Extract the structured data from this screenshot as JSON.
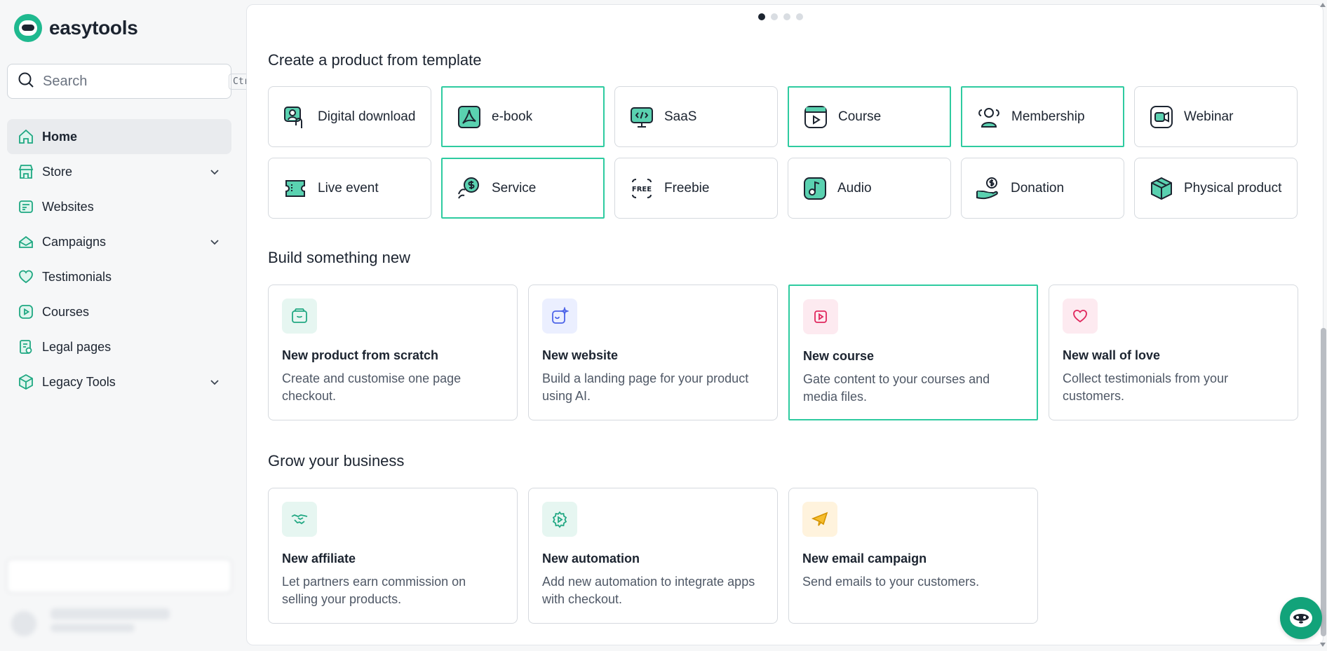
{
  "brand": {
    "name": "easytools",
    "accent": "#2ecba0"
  },
  "search": {
    "placeholder": "Search",
    "shortcut": "Ctrl+K"
  },
  "sidebar": {
    "items": [
      {
        "label": "Home",
        "icon": "home-icon",
        "active": true,
        "expandable": false
      },
      {
        "label": "Store",
        "icon": "store-icon",
        "expandable": true
      },
      {
        "label": "Websites",
        "icon": "websites-icon",
        "expandable": false
      },
      {
        "label": "Campaigns",
        "icon": "campaigns-icon",
        "expandable": true
      },
      {
        "label": "Testimonials",
        "icon": "heart-icon",
        "expandable": false
      },
      {
        "label": "Courses",
        "icon": "play-icon",
        "expandable": false
      },
      {
        "label": "Legal pages",
        "icon": "legal-icon",
        "expandable": false
      },
      {
        "label": "Legacy Tools",
        "icon": "box-icon",
        "expandable": true
      }
    ]
  },
  "carousel": {
    "pages": 4,
    "active": 1
  },
  "templates": {
    "title": "Create a product from template",
    "items": [
      {
        "label": "Digital download",
        "icon": "digital-download-icon",
        "highlighted": false
      },
      {
        "label": "e-book",
        "icon": "ebook-icon",
        "highlighted": true
      },
      {
        "label": "SaaS",
        "icon": "saas-icon",
        "highlighted": false
      },
      {
        "label": "Course",
        "icon": "course-icon",
        "highlighted": true
      },
      {
        "label": "Membership",
        "icon": "membership-icon",
        "highlighted": true
      },
      {
        "label": "Webinar",
        "icon": "webinar-icon",
        "highlighted": false
      },
      {
        "label": "Live event",
        "icon": "ticket-icon",
        "highlighted": false
      },
      {
        "label": "Service",
        "icon": "service-icon",
        "highlighted": true
      },
      {
        "label": "Freebie",
        "icon": "free-icon",
        "highlighted": false
      },
      {
        "label": "Audio",
        "icon": "audio-icon",
        "highlighted": false
      },
      {
        "label": "Donation",
        "icon": "donation-icon",
        "highlighted": false
      },
      {
        "label": "Physical product",
        "icon": "package-icon",
        "highlighted": false
      }
    ]
  },
  "build": {
    "title": "Build something new",
    "items": [
      {
        "title": "New product from scratch",
        "desc": "Create and customise one page checkout.",
        "icon": "wallet-icon",
        "tint": "#e6f6f1",
        "highlighted": false
      },
      {
        "title": "New website",
        "desc": "Build a landing page for your product using AI.",
        "icon": "ai-website-icon",
        "tint": "#ebefff",
        "highlighted": false
      },
      {
        "title": "New course",
        "desc": "Gate content to your courses and media files.",
        "icon": "video-icon",
        "tint": "#fdeaf0",
        "highlighted": true
      },
      {
        "title": "New wall of love",
        "desc": "Collect testimonials from your customers.",
        "icon": "heart-icon",
        "tint": "#fdeaf0",
        "highlighted": false
      }
    ]
  },
  "grow": {
    "title": "Grow your business",
    "items": [
      {
        "title": "New affiliate",
        "desc": "Let partners earn commission on selling your products.",
        "icon": "handshake-icon",
        "tint": "#e6f6f1"
      },
      {
        "title": "New automation",
        "desc": "Add new automation to integrate apps with checkout.",
        "icon": "automation-icon",
        "tint": "#e6f6f1"
      },
      {
        "title": "New email campaign",
        "desc": "Send emails to your customers.",
        "icon": "paper-plane-icon",
        "tint": "#fff3dd"
      }
    ]
  }
}
